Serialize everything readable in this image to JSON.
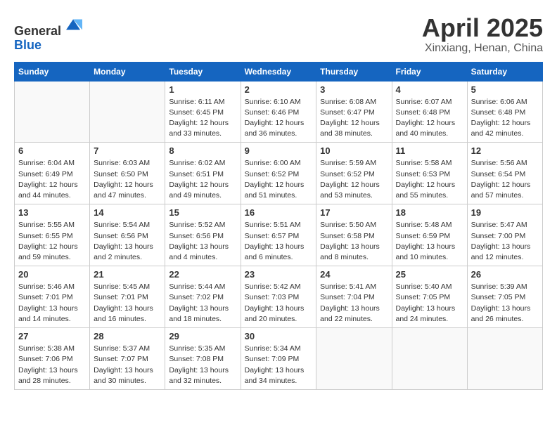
{
  "header": {
    "logo_line1": "General",
    "logo_line2": "Blue",
    "title": "April 2025",
    "subtitle": "Xinxiang, Henan, China"
  },
  "weekdays": [
    "Sunday",
    "Monday",
    "Tuesday",
    "Wednesday",
    "Thursday",
    "Friday",
    "Saturday"
  ],
  "weeks": [
    [
      {
        "day": "",
        "info": ""
      },
      {
        "day": "",
        "info": ""
      },
      {
        "day": "1",
        "info": "Sunrise: 6:11 AM\nSunset: 6:45 PM\nDaylight: 12 hours\nand 33 minutes."
      },
      {
        "day": "2",
        "info": "Sunrise: 6:10 AM\nSunset: 6:46 PM\nDaylight: 12 hours\nand 36 minutes."
      },
      {
        "day": "3",
        "info": "Sunrise: 6:08 AM\nSunset: 6:47 PM\nDaylight: 12 hours\nand 38 minutes."
      },
      {
        "day": "4",
        "info": "Sunrise: 6:07 AM\nSunset: 6:48 PM\nDaylight: 12 hours\nand 40 minutes."
      },
      {
        "day": "5",
        "info": "Sunrise: 6:06 AM\nSunset: 6:48 PM\nDaylight: 12 hours\nand 42 minutes."
      }
    ],
    [
      {
        "day": "6",
        "info": "Sunrise: 6:04 AM\nSunset: 6:49 PM\nDaylight: 12 hours\nand 44 minutes."
      },
      {
        "day": "7",
        "info": "Sunrise: 6:03 AM\nSunset: 6:50 PM\nDaylight: 12 hours\nand 47 minutes."
      },
      {
        "day": "8",
        "info": "Sunrise: 6:02 AM\nSunset: 6:51 PM\nDaylight: 12 hours\nand 49 minutes."
      },
      {
        "day": "9",
        "info": "Sunrise: 6:00 AM\nSunset: 6:52 PM\nDaylight: 12 hours\nand 51 minutes."
      },
      {
        "day": "10",
        "info": "Sunrise: 5:59 AM\nSunset: 6:52 PM\nDaylight: 12 hours\nand 53 minutes."
      },
      {
        "day": "11",
        "info": "Sunrise: 5:58 AM\nSunset: 6:53 PM\nDaylight: 12 hours\nand 55 minutes."
      },
      {
        "day": "12",
        "info": "Sunrise: 5:56 AM\nSunset: 6:54 PM\nDaylight: 12 hours\nand 57 minutes."
      }
    ],
    [
      {
        "day": "13",
        "info": "Sunrise: 5:55 AM\nSunset: 6:55 PM\nDaylight: 12 hours\nand 59 minutes."
      },
      {
        "day": "14",
        "info": "Sunrise: 5:54 AM\nSunset: 6:56 PM\nDaylight: 13 hours\nand 2 minutes."
      },
      {
        "day": "15",
        "info": "Sunrise: 5:52 AM\nSunset: 6:56 PM\nDaylight: 13 hours\nand 4 minutes."
      },
      {
        "day": "16",
        "info": "Sunrise: 5:51 AM\nSunset: 6:57 PM\nDaylight: 13 hours\nand 6 minutes."
      },
      {
        "day": "17",
        "info": "Sunrise: 5:50 AM\nSunset: 6:58 PM\nDaylight: 13 hours\nand 8 minutes."
      },
      {
        "day": "18",
        "info": "Sunrise: 5:48 AM\nSunset: 6:59 PM\nDaylight: 13 hours\nand 10 minutes."
      },
      {
        "day": "19",
        "info": "Sunrise: 5:47 AM\nSunset: 7:00 PM\nDaylight: 13 hours\nand 12 minutes."
      }
    ],
    [
      {
        "day": "20",
        "info": "Sunrise: 5:46 AM\nSunset: 7:01 PM\nDaylight: 13 hours\nand 14 minutes."
      },
      {
        "day": "21",
        "info": "Sunrise: 5:45 AM\nSunset: 7:01 PM\nDaylight: 13 hours\nand 16 minutes."
      },
      {
        "day": "22",
        "info": "Sunrise: 5:44 AM\nSunset: 7:02 PM\nDaylight: 13 hours\nand 18 minutes."
      },
      {
        "day": "23",
        "info": "Sunrise: 5:42 AM\nSunset: 7:03 PM\nDaylight: 13 hours\nand 20 minutes."
      },
      {
        "day": "24",
        "info": "Sunrise: 5:41 AM\nSunset: 7:04 PM\nDaylight: 13 hours\nand 22 minutes."
      },
      {
        "day": "25",
        "info": "Sunrise: 5:40 AM\nSunset: 7:05 PM\nDaylight: 13 hours\nand 24 minutes."
      },
      {
        "day": "26",
        "info": "Sunrise: 5:39 AM\nSunset: 7:05 PM\nDaylight: 13 hours\nand 26 minutes."
      }
    ],
    [
      {
        "day": "27",
        "info": "Sunrise: 5:38 AM\nSunset: 7:06 PM\nDaylight: 13 hours\nand 28 minutes."
      },
      {
        "day": "28",
        "info": "Sunrise: 5:37 AM\nSunset: 7:07 PM\nDaylight: 13 hours\nand 30 minutes."
      },
      {
        "day": "29",
        "info": "Sunrise: 5:35 AM\nSunset: 7:08 PM\nDaylight: 13 hours\nand 32 minutes."
      },
      {
        "day": "30",
        "info": "Sunrise: 5:34 AM\nSunset: 7:09 PM\nDaylight: 13 hours\nand 34 minutes."
      },
      {
        "day": "",
        "info": ""
      },
      {
        "day": "",
        "info": ""
      },
      {
        "day": "",
        "info": ""
      }
    ]
  ]
}
